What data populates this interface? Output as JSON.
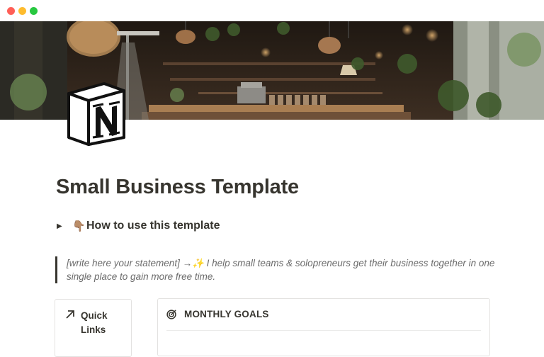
{
  "window": {
    "controls": [
      "close",
      "minimize",
      "maximize"
    ]
  },
  "cover": {
    "description_icon": "cafe-interior-cover-image"
  },
  "page_icon": {
    "name": "notion-logo-icon"
  },
  "page": {
    "title": "Small Business Template",
    "toggle": {
      "arrow": "▶",
      "emoji": "👇🏽",
      "label": "How to use this template"
    },
    "quote": "[write here your statement] →✨ I help small teams & solopreneurs get their business together in one single place to gain more free time."
  },
  "quick_links": {
    "icon": "arrow-up-right-icon",
    "title": "Quick Links"
  },
  "monthly_goals": {
    "icon": "target-icon",
    "title": "MONTHLY GOALS"
  }
}
